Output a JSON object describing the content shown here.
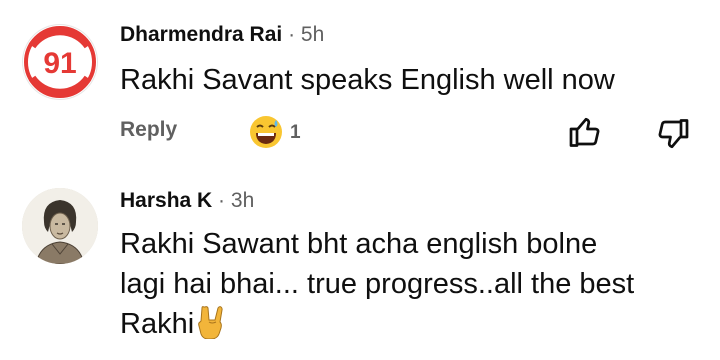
{
  "comments": [
    {
      "avatar_text": "91",
      "author": "Dharmendra Rai",
      "separator": "·",
      "time": "5h",
      "text": "Rakhi Savant speaks English well now",
      "reply_label": "Reply",
      "reaction_icon": "grinning-sweat-emoji",
      "reaction_count": "1",
      "like_icon": "thumbs-up-icon",
      "dislike_icon": "thumbs-down-icon"
    },
    {
      "avatar_icon": "person-sketch-avatar",
      "author": "Harsha K",
      "separator": "·",
      "time": "3h",
      "text_lines": [
        "Rakhi Sawant bht acha english bolne",
        "lagi hai bhai... true progress..all the best",
        "Rakhi"
      ],
      "trailing_emoji": "rock-on-hand-emoji"
    }
  ],
  "colors": {
    "avatar_red": "#e53935",
    "meta_gray": "#606060",
    "emoji_yellow": "#f9c631"
  }
}
